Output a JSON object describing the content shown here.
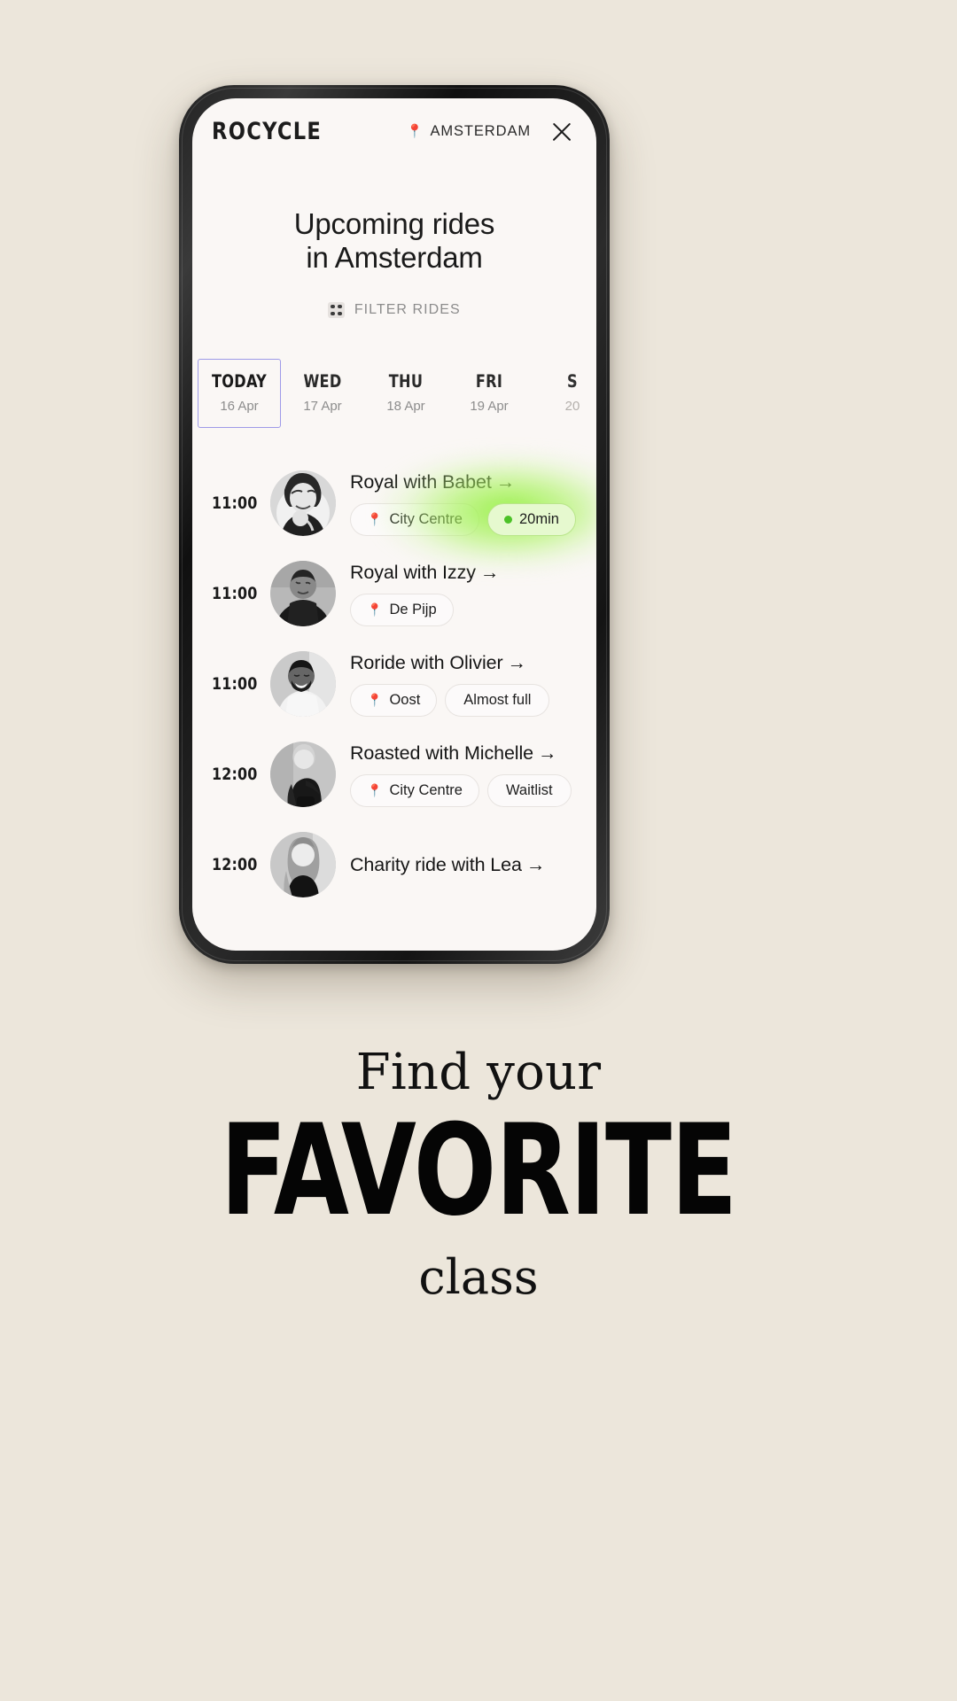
{
  "app": {
    "brand": "ROCYCLE",
    "city": "AMSTERDAM",
    "pin_icon": "round-pushpin",
    "close_icon": "close-icon"
  },
  "title": {
    "line1": "Upcoming rides",
    "line2": "in Amsterdam"
  },
  "filter": {
    "label": "FILTER RIDES",
    "icon": "grid-dots-icon"
  },
  "day_tabs": [
    {
      "name": "TODAY",
      "date": "16 Apr",
      "active": true
    },
    {
      "name": "WED",
      "date": "17 Apr",
      "active": false
    },
    {
      "name": "THU",
      "date": "18 Apr",
      "active": false
    },
    {
      "name": "FRI",
      "date": "19 Apr",
      "active": false
    },
    {
      "name": "S",
      "date": "20",
      "active": false
    }
  ],
  "rides": [
    {
      "time": "11:00",
      "title": "Royal with Babet",
      "arrow": "→",
      "location": "City Centre",
      "badge": "20min",
      "badge_type": "timer"
    },
    {
      "time": "11:00",
      "title": "Royal with Izzy",
      "arrow": "→",
      "location": "De Pijp",
      "badge": "",
      "badge_type": "none"
    },
    {
      "time": "11:00",
      "title": "Roride with Olivier",
      "arrow": "→",
      "location": "Oost",
      "badge": "Almost full",
      "badge_type": "plain"
    },
    {
      "time": "12:00",
      "title": "Roasted with Michelle",
      "arrow": "→",
      "location": "City Centre",
      "badge": "Waitlist",
      "badge_type": "plain"
    },
    {
      "time": "12:00",
      "title": "Charity ride with Lea",
      "arrow": "→",
      "location": "",
      "badge": "",
      "badge_type": "none"
    }
  ],
  "headline": {
    "line1": "Find your",
    "line2": "FAVORITE",
    "line3": "class"
  },
  "colors": {
    "page_background": "#ece6db",
    "screen_background": "#faf7f5",
    "accent_active_tab": "#9e9ae8",
    "accent_green": "#92f03c",
    "pin_red": "#e02b1d",
    "text_primary": "#161616",
    "text_muted": "#8c8c8c"
  }
}
